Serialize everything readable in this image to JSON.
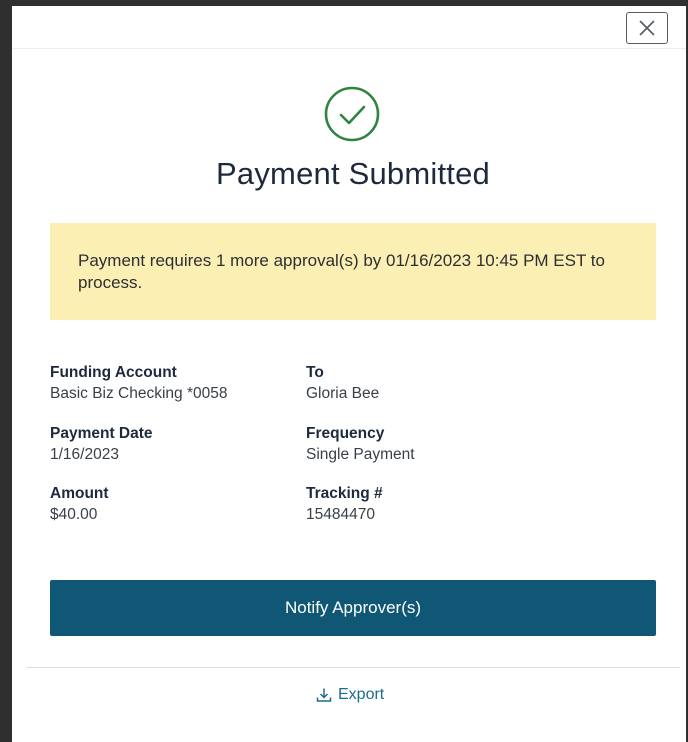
{
  "modal": {
    "title": "Payment Submitted",
    "close_icon": "close-icon",
    "success_icon": "check-circle-icon"
  },
  "notice": {
    "text": "Payment requires 1 more approval(s) by 01/16/2023 10:45 PM EST to process."
  },
  "details": {
    "funding_account": {
      "label": "Funding Account",
      "value": "Basic Biz Checking *0058"
    },
    "to": {
      "label": "To",
      "value": "Gloria Bee"
    },
    "payment_date": {
      "label": "Payment Date",
      "value": "1/16/2023"
    },
    "frequency": {
      "label": "Frequency",
      "value": "Single Payment"
    },
    "amount": {
      "label": "Amount",
      "value": "$40.00"
    },
    "tracking": {
      "label": "Tracking #",
      "value": "15484470"
    }
  },
  "actions": {
    "notify_label": "Notify Approver(s)",
    "export_label": "Export",
    "export_icon": "download-icon"
  },
  "colors": {
    "primary": "#0f5775",
    "success": "#2e8540",
    "notice_bg": "#fcefb4",
    "link": "#1d6a8c"
  }
}
